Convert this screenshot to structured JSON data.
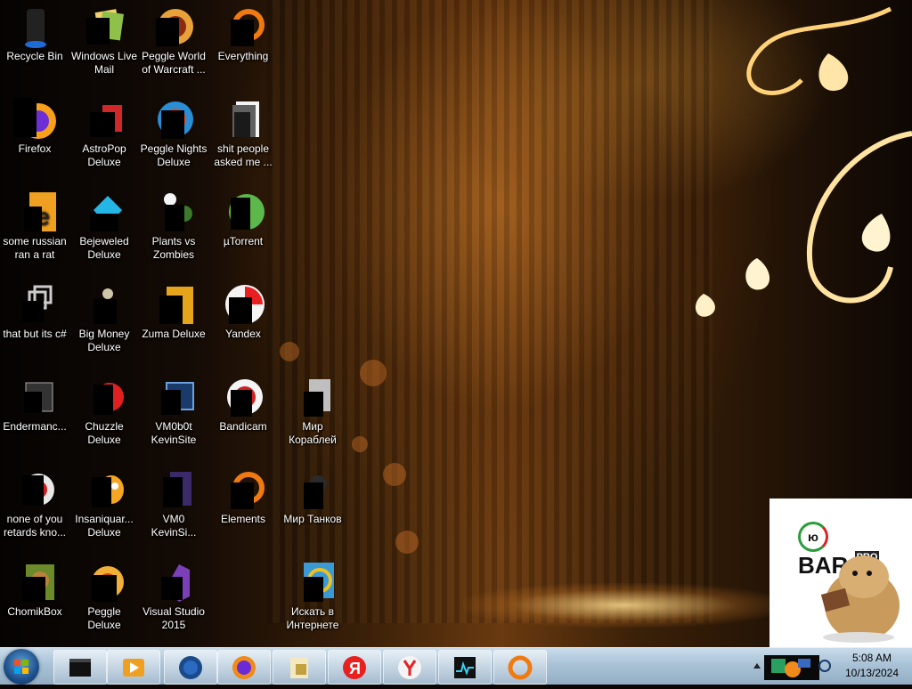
{
  "desktop": {
    "icons": [
      {
        "label": "Recycle Bin"
      },
      {
        "label": "Windows Live Mail"
      },
      {
        "label": "Peggle World of Warcraft ..."
      },
      {
        "label": "Everything"
      },
      {
        "label": "Firefox"
      },
      {
        "label": "AstroPop Deluxe"
      },
      {
        "label": "Peggle Nights Deluxe"
      },
      {
        "label": "shit people asked me ..."
      },
      {
        "label": "some russian ran a rat"
      },
      {
        "label": "Bejeweled Deluxe"
      },
      {
        "label": "Plants vs Zombies"
      },
      {
        "label": "µTorrent"
      },
      {
        "label": "that but its c#"
      },
      {
        "label": "Big Money Deluxe"
      },
      {
        "label": "Zuma Deluxe"
      },
      {
        "label": "Yandex"
      },
      {
        "label": "Endermanc..."
      },
      {
        "label": "Chuzzle Deluxe"
      },
      {
        "label": "VM0b0t KevinSite"
      },
      {
        "label": "Bandicam"
      },
      {
        "label": "Мир Кораблей"
      },
      {
        "label": "none of you retards kno..."
      },
      {
        "label": "Insaniquar... Deluxe"
      },
      {
        "label": "VM0 KevinSi..."
      },
      {
        "label": "Elements"
      },
      {
        "label": "Мир Танков"
      },
      {
        "label": "ChomikBox"
      },
      {
        "label": "Peggle Deluxe"
      },
      {
        "label": "Visual Studio 2015"
      },
      {
        "label": "Искать в Интернете"
      }
    ]
  },
  "ad": {
    "logo_prefix": "ю",
    "logo_text": "BAR.",
    "logo_suffix": "PRO"
  },
  "taskbar": {
    "pinned": [
      {
        "icon": "terminal-icon"
      },
      {
        "icon": "media-player-icon"
      },
      {
        "icon": "globe-icon"
      },
      {
        "icon": "firefox-icon"
      },
      {
        "icon": "notepad-icon"
      },
      {
        "icon": "yandex-icon"
      },
      {
        "icon": "yandex-browser-icon"
      },
      {
        "icon": "monitor-icon"
      },
      {
        "icon": "everything-icon"
      }
    ],
    "clock": {
      "time": "5:08 AM",
      "date": "10/13/2024"
    }
  }
}
